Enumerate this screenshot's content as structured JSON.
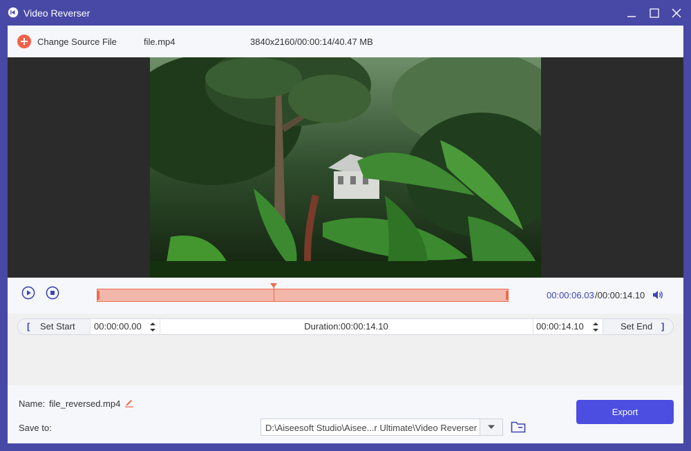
{
  "titlebar": {
    "title": "Video Reverser"
  },
  "source": {
    "change_label": "Change Source File",
    "filename": "file.mp4",
    "info": "3840x2160/00:00:14/40.47 MB"
  },
  "player": {
    "current_time": "00:00:06.03",
    "total_time": "/00:00:14.10",
    "playhead_fraction": 0.43
  },
  "range": {
    "set_start_label": "Set Start",
    "start_value": "00:00:00.00",
    "duration": "Duration:00:00:14.10",
    "end_value": "00:00:14.10",
    "set_end_label": "Set End"
  },
  "output": {
    "name_label": "Name:",
    "name_value": "file_reversed.mp4",
    "save_label": "Save to:",
    "save_path": "D:\\Aiseesoft Studio\\Aisee...r Ultimate\\Video Reverser",
    "export_label": "Export"
  },
  "colors": {
    "accent": "#4b4ee0",
    "trim": "#ef6a4f",
    "time_current": "#3b45b8",
    "frame_bg": "#4848a6"
  },
  "icons": [
    "app-logo-icon",
    "minimize-icon",
    "maximize-icon",
    "close-icon",
    "add-icon",
    "play-icon",
    "stop-icon",
    "volume-icon",
    "edit-icon",
    "chevron-down-icon",
    "folder-icon"
  ]
}
